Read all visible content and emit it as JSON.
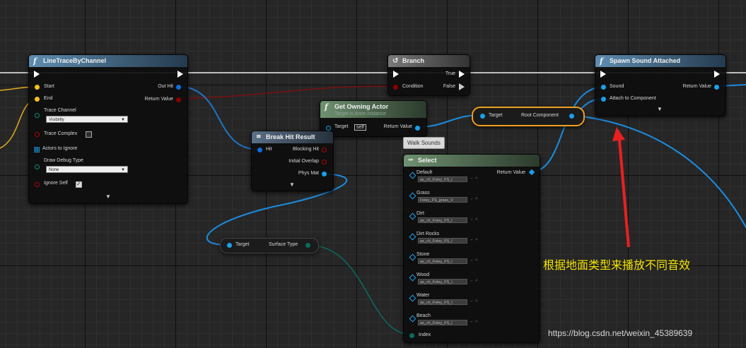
{
  "nodes": {
    "line_trace": {
      "icon": "f",
      "title": "LineTraceByChannel",
      "start": "Start",
      "end": "End",
      "trace_channel": "Trace Channel",
      "trace_channel_value": "Visibility",
      "trace_complex": "Trace Complex",
      "actors_to_ignore": "Actors to Ignore",
      "draw_debug_type": "Draw Debug Type",
      "draw_debug_value": "None",
      "ignore_self": "Ignore Self",
      "out_hit": "Out Hit",
      "return_value": "Return Value"
    },
    "branch": {
      "title": "Branch",
      "condition": "Condition",
      "true_label": "True",
      "false_label": "False"
    },
    "spawn_sound": {
      "icon": "f",
      "title": "Spawn Sound Attached",
      "sound": "Sound",
      "attach": "Attach to Component",
      "return_value": "Return Value"
    },
    "get_owning_actor": {
      "icon": "f",
      "title": "Get Owning Actor",
      "subtitle": "Target is Anim Instance",
      "target": "Target",
      "target_value": "self",
      "return_value": "Return Value"
    },
    "root_component": {
      "target": "Target",
      "output": "Root Component"
    },
    "break_hit": {
      "title": "Break Hit Result",
      "hit": "Hit",
      "blocking_hit": "Blocking Hit",
      "initial_overlap": "Initial Overlap",
      "phys_mat": "Phys Mat"
    },
    "surface_type": {
      "target": "Target",
      "output": "Surface Type"
    },
    "select": {
      "title": "Select",
      "return_value": "Return Value",
      "index": "Index",
      "options": [
        {
          "label": "Default",
          "value": "as_ch_Foley_FS_l"
        },
        {
          "label": "Grass",
          "value": "Foley_FS_grass_V"
        },
        {
          "label": "Dirt",
          "value": "as_ch_Foley_FS_l"
        },
        {
          "label": "Dirt Rocks",
          "value": "as_ch_Foley_FS_l"
        },
        {
          "label": "Stone",
          "value": "as_ch_Foley_FS_l"
        },
        {
          "label": "Wood",
          "value": "as_ch_Foley_FS_\\"
        },
        {
          "label": "Water",
          "value": "as_ch_Foley_FS_\\"
        },
        {
          "label": "Beach",
          "value": "as_ch_Foley_FS_l"
        }
      ]
    }
  },
  "tooltip": "Walk Sounds",
  "annotation": "根据地面类型来播放不同音效",
  "watermark": "https://blog.csdn.net/weixin_45389639",
  "colors": {
    "exec": "#ffffff",
    "vector": "#f8c11c",
    "struct": "#0a6ee0",
    "object": "#1aa0e8",
    "bool": "#8b0000",
    "enum": "#0b6b5e",
    "annotation_arrow": "#e82020",
    "annotation_text": "#f5e400"
  }
}
